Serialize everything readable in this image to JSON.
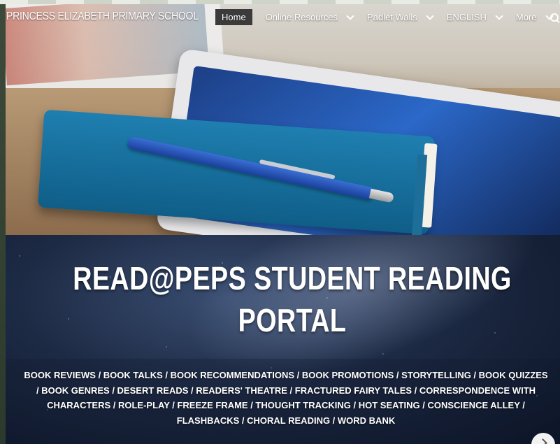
{
  "site": {
    "title": "PRINCESS ELIZABETH PRIMARY SCHOOL"
  },
  "nav": {
    "items": [
      {
        "label": "Home",
        "active": true,
        "dropdown": false
      },
      {
        "label": "Online Resources",
        "active": false,
        "dropdown": true
      },
      {
        "label": "Padlet Walls",
        "active": false,
        "dropdown": true
      },
      {
        "label": "ENGLISH",
        "active": false,
        "dropdown": true
      },
      {
        "label": "More",
        "active": false,
        "dropdown": true
      }
    ],
    "search_icon": "search-icon"
  },
  "banner": {
    "title_line1": "READ@PEPS STUDENT READING",
    "title_line2": "PORTAL",
    "topics": "BOOK REVIEWS  / BOOK TALKS / BOOK RECOMMENDATIONS / BOOK PROMOTIONS / STORYTELLING / BOOK QUIZZES / BOOK GENRES / DESERT READS / READERS' THEATRE / FRACTURED FAIRY TALES / CORRESPONDENCE WITH CHARACTERS / ROLE-PLAY / FREEZE FRAME / THOUGHT TRACKING / HOT SEATING / CONSCIENCE ALLEY / FLASHBACKS / CHORAL READING / WORD BANK"
  },
  "colors": {
    "active_nav_bg": "#3b3b3b",
    "banner_text": "#ffffff"
  }
}
